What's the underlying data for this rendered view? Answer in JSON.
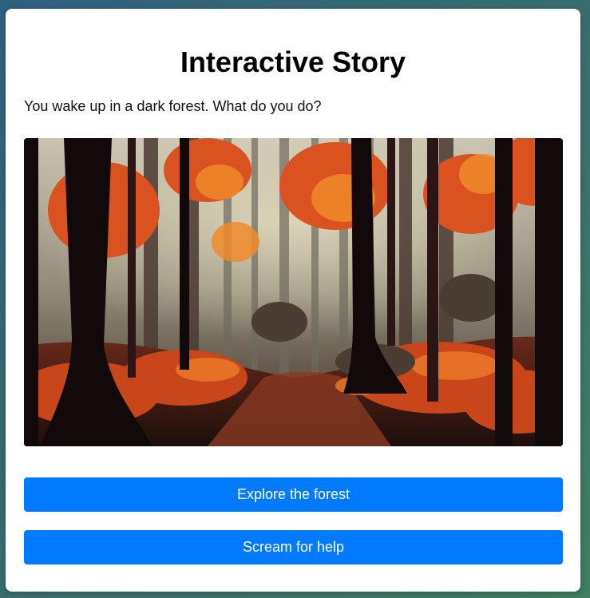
{
  "story": {
    "title": "Interactive Story",
    "prompt": "You wake up in a dark forest. What do you do?",
    "choices": [
      {
        "label": "Explore the forest"
      },
      {
        "label": "Scream for help"
      }
    ]
  },
  "colors": {
    "button": "#007bff",
    "button_text": "#ffffff",
    "card": "#ffffff",
    "background_start": "#2f5f7f",
    "background_end": "#3f7f62"
  },
  "icons": {
    "scene_image": "autumn-forest-illustration"
  }
}
